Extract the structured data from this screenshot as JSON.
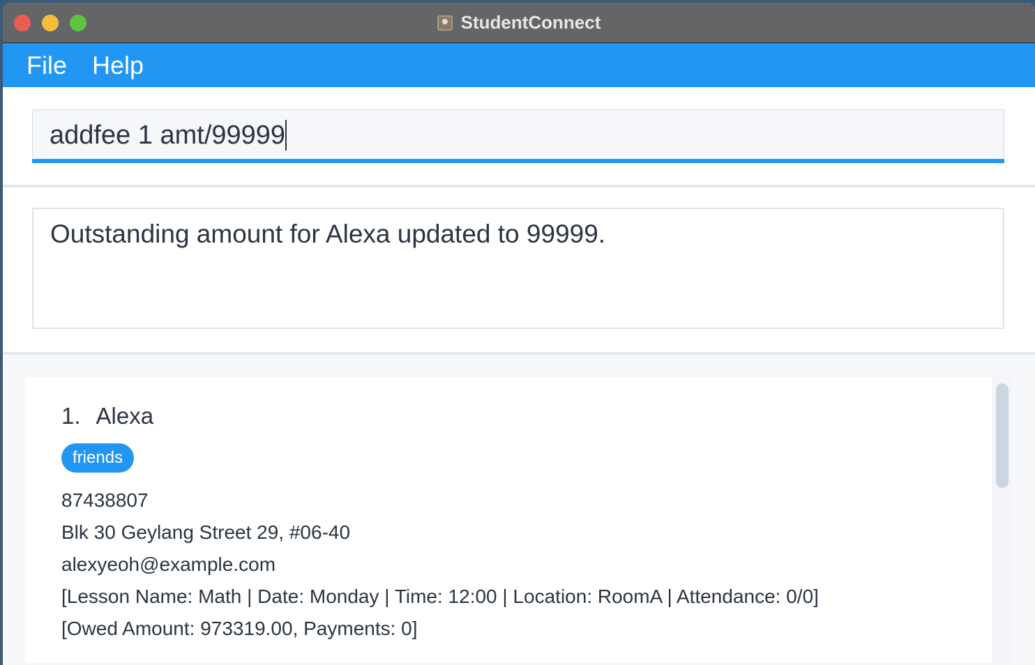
{
  "window": {
    "title": "StudentConnect"
  },
  "menu": {
    "file": "File",
    "help": "Help"
  },
  "command": {
    "value": "addfee 1 amt/99999"
  },
  "result": {
    "message": "Outstanding amount for Alexa updated to 99999."
  },
  "persons": [
    {
      "index": "1.",
      "name": "Alexa",
      "tags": [
        "friends"
      ],
      "phone": "87438807",
      "address": "Blk 30 Geylang Street 29, #06-40",
      "email": "alexyeoh@example.com",
      "lessons": "[Lesson Name: Math | Date: Monday | Time: 12:00 | Location: RoomA | Attendance: 0/0]",
      "fees": "[Owed Amount: 973319.00, Payments: 0]"
    }
  ],
  "colors": {
    "accent": "#2196f3",
    "titlebar": "#646566",
    "text": "#2b3440"
  }
}
